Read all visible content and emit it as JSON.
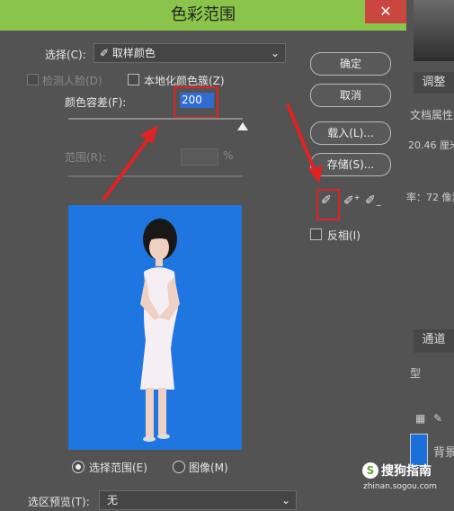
{
  "dialog": {
    "title": "色彩范围",
    "close_icon": "close-icon",
    "select_label": "选择(C):",
    "select_value": "取样颜色",
    "detect_faces_label": "检测人脸(D)",
    "localized_clusters_label": "本地化颜色簇(Z)",
    "fuzziness_label": "颜色容差(F):",
    "fuzziness_value": "200",
    "range_label": "范围(R):",
    "range_unit": "%",
    "radio_selection_label": "选择范围(E)",
    "radio_image_label": "图像(M)",
    "preview_label": "选区预览(T):",
    "preview_value": "无",
    "invert_label": "反相(I)",
    "fuzziness_fraction": 1.0
  },
  "buttons": {
    "ok": "确定",
    "cancel": "取消",
    "load": "载入(L)...",
    "save": "存储(S)..."
  },
  "eyedroppers": [
    "eyedropper-icon",
    "eyedropper-plus-icon",
    "eyedropper-minus-icon"
  ],
  "background_panel": {
    "adjust_tab": "调整",
    "doc_props": "文档属性",
    "res_text": "20.46 厘米",
    "dpi_text": "率：72 像素",
    "channels_tab": "通道",
    "type_text": "型",
    "layer_name": "背景"
  },
  "watermark": {
    "brand": "搜狗指南",
    "url": "zhinan.sogou.com"
  }
}
